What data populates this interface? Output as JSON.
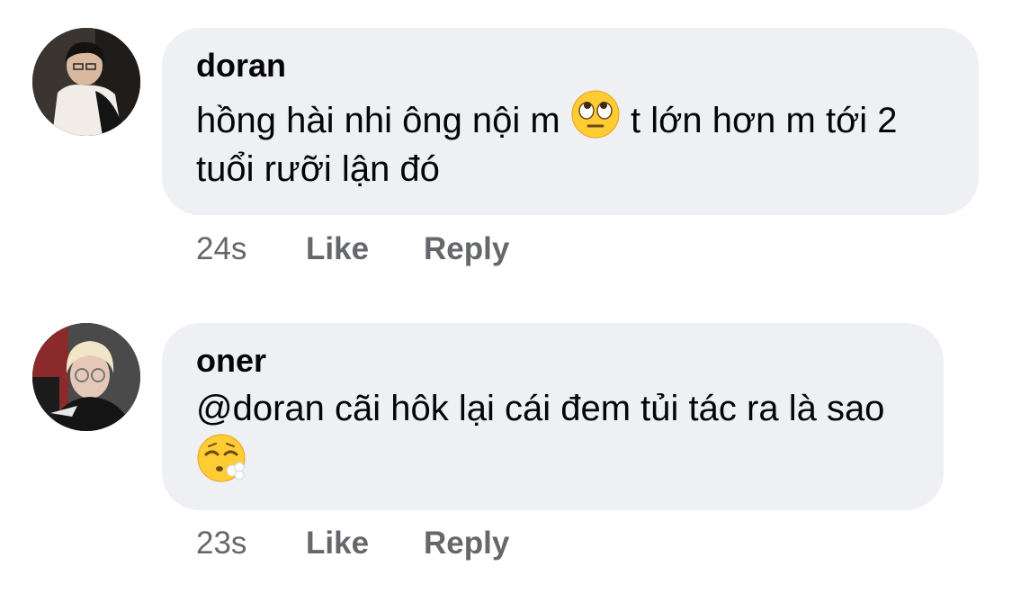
{
  "comments": [
    {
      "author": "doran",
      "text_part1": "hồng hài nhi ông nội m",
      "emoji": "face-with-rolling-eyes",
      "text_part2": " t lớn hơn m tới 2 tuổi rưỡi lận đó",
      "time": "24s",
      "like_label": "Like",
      "reply_label": "Reply"
    },
    {
      "author": "oner",
      "text_part1": "@doran cãi hôk lại cái đem tủi tác ra là sao",
      "emoji": "face-exhaling",
      "text_part2": "",
      "time": "23s",
      "like_label": "Like",
      "reply_label": "Reply"
    }
  ],
  "colors": {
    "bubble_bg": "#eef0f3",
    "author_text": "#050505",
    "meta_text": "#65676b"
  }
}
